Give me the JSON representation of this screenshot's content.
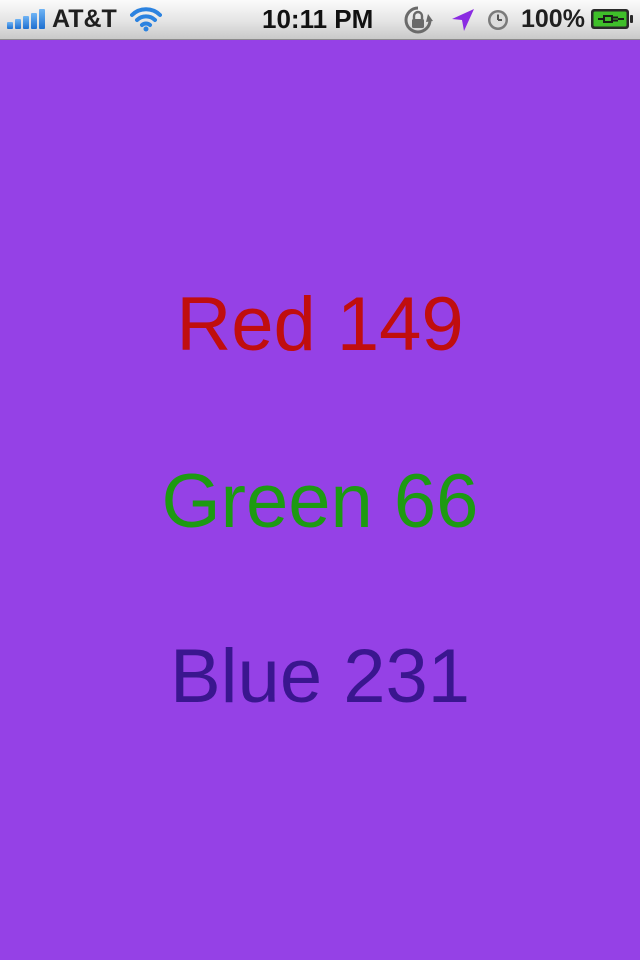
{
  "status_bar": {
    "carrier": "AT&T",
    "time": "10:11 PM",
    "battery_percent": "100%",
    "icons": [
      "signal-bars-icon",
      "wifi-icon",
      "rotation-lock-icon",
      "location-arrow-icon",
      "alarm-clock-icon",
      "battery-charging-icon"
    ]
  },
  "background_color": "#9541e6",
  "labels": {
    "red": {
      "text": "Red 149",
      "color": "#c00e0e"
    },
    "green": {
      "text": "Green 66",
      "color": "#1d9a12"
    },
    "blue": {
      "text": "Blue 231",
      "color": "#3a168f"
    }
  }
}
